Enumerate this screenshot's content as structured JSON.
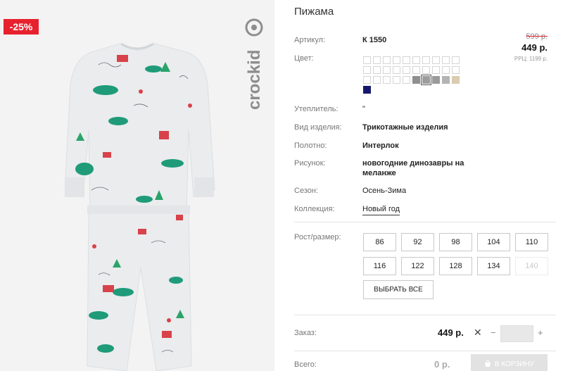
{
  "badge": {
    "discount": "-25%"
  },
  "brand": {
    "logo_text": "crockid"
  },
  "product": {
    "title": "Пижама",
    "article_label": "Артикул:",
    "article": "К 1550",
    "color_label": "Цвет:",
    "insulation_label": "Утеплитель:",
    "insulation": "\"",
    "type_label": "Вид изделия:",
    "type": "Трикотажные изделия",
    "fabric_label": "Полотно:",
    "fabric": "Интерлок",
    "print_label": "Рисунок:",
    "print_line1": "новогодние динозавры на",
    "print_line2": "меланже",
    "season_label": "Сезон:",
    "season": "Осень-Зима",
    "collection_label": "Коллекция:",
    "collection": "Новый год"
  },
  "price": {
    "old": "599 р.",
    "new": "449 р.",
    "rrp": "РРЦ: 1199 р."
  },
  "swatch_colors": {
    "gray1": "#9a9a9a",
    "gray2": "#b4b4b4",
    "beige": "#d9ccb0",
    "navy": "#16196b",
    "gray_dark": "#8f8f8f",
    "gray_sel": "#9d9d9d"
  },
  "sizes": {
    "label": "Рост/размер:",
    "items": [
      "86",
      "92",
      "98",
      "104",
      "110",
      "116",
      "122",
      "128",
      "134",
      "140"
    ],
    "select_all": "ВЫБРАТЬ ВСЕ"
  },
  "order": {
    "label": "Заказ:",
    "price": "449 р.",
    "x": "✕",
    "minus": "−",
    "plus": "+"
  },
  "total": {
    "label": "Всего:",
    "price": "0 р.",
    "cart_button": "В КОРЗИНУ"
  }
}
